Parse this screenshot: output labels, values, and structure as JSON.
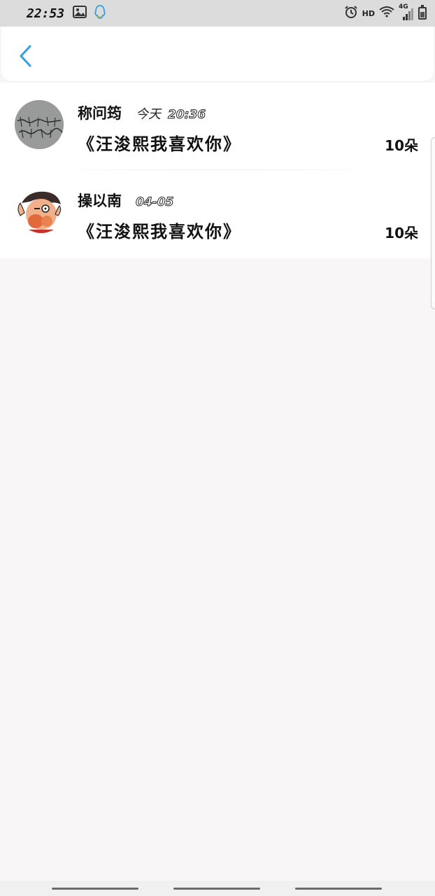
{
  "status_bar": {
    "time": "22:53",
    "network_label": "HD",
    "signal_label": "4G",
    "icons": [
      "gallery-icon",
      "qq-icon",
      "alarm-icon",
      "wifi-icon",
      "signal-icon",
      "battery-icon"
    ]
  },
  "header": {
    "back_icon": "chevron-left-icon",
    "accent_color": "#2f9fe0"
  },
  "list": {
    "items": [
      {
        "nickname": "称问筠",
        "time_prefix": "今天",
        "time": "20:36",
        "message": "《汪浚熙我喜欢你》",
        "count": "10朵",
        "avatar_icon": "handwriting-avatar"
      },
      {
        "nickname": "操以南",
        "time_prefix": "",
        "time": "04-05",
        "message": "《汪浚熙我喜欢你》",
        "count": "10朵",
        "avatar_icon": "cartoon-face-avatar"
      }
    ]
  }
}
